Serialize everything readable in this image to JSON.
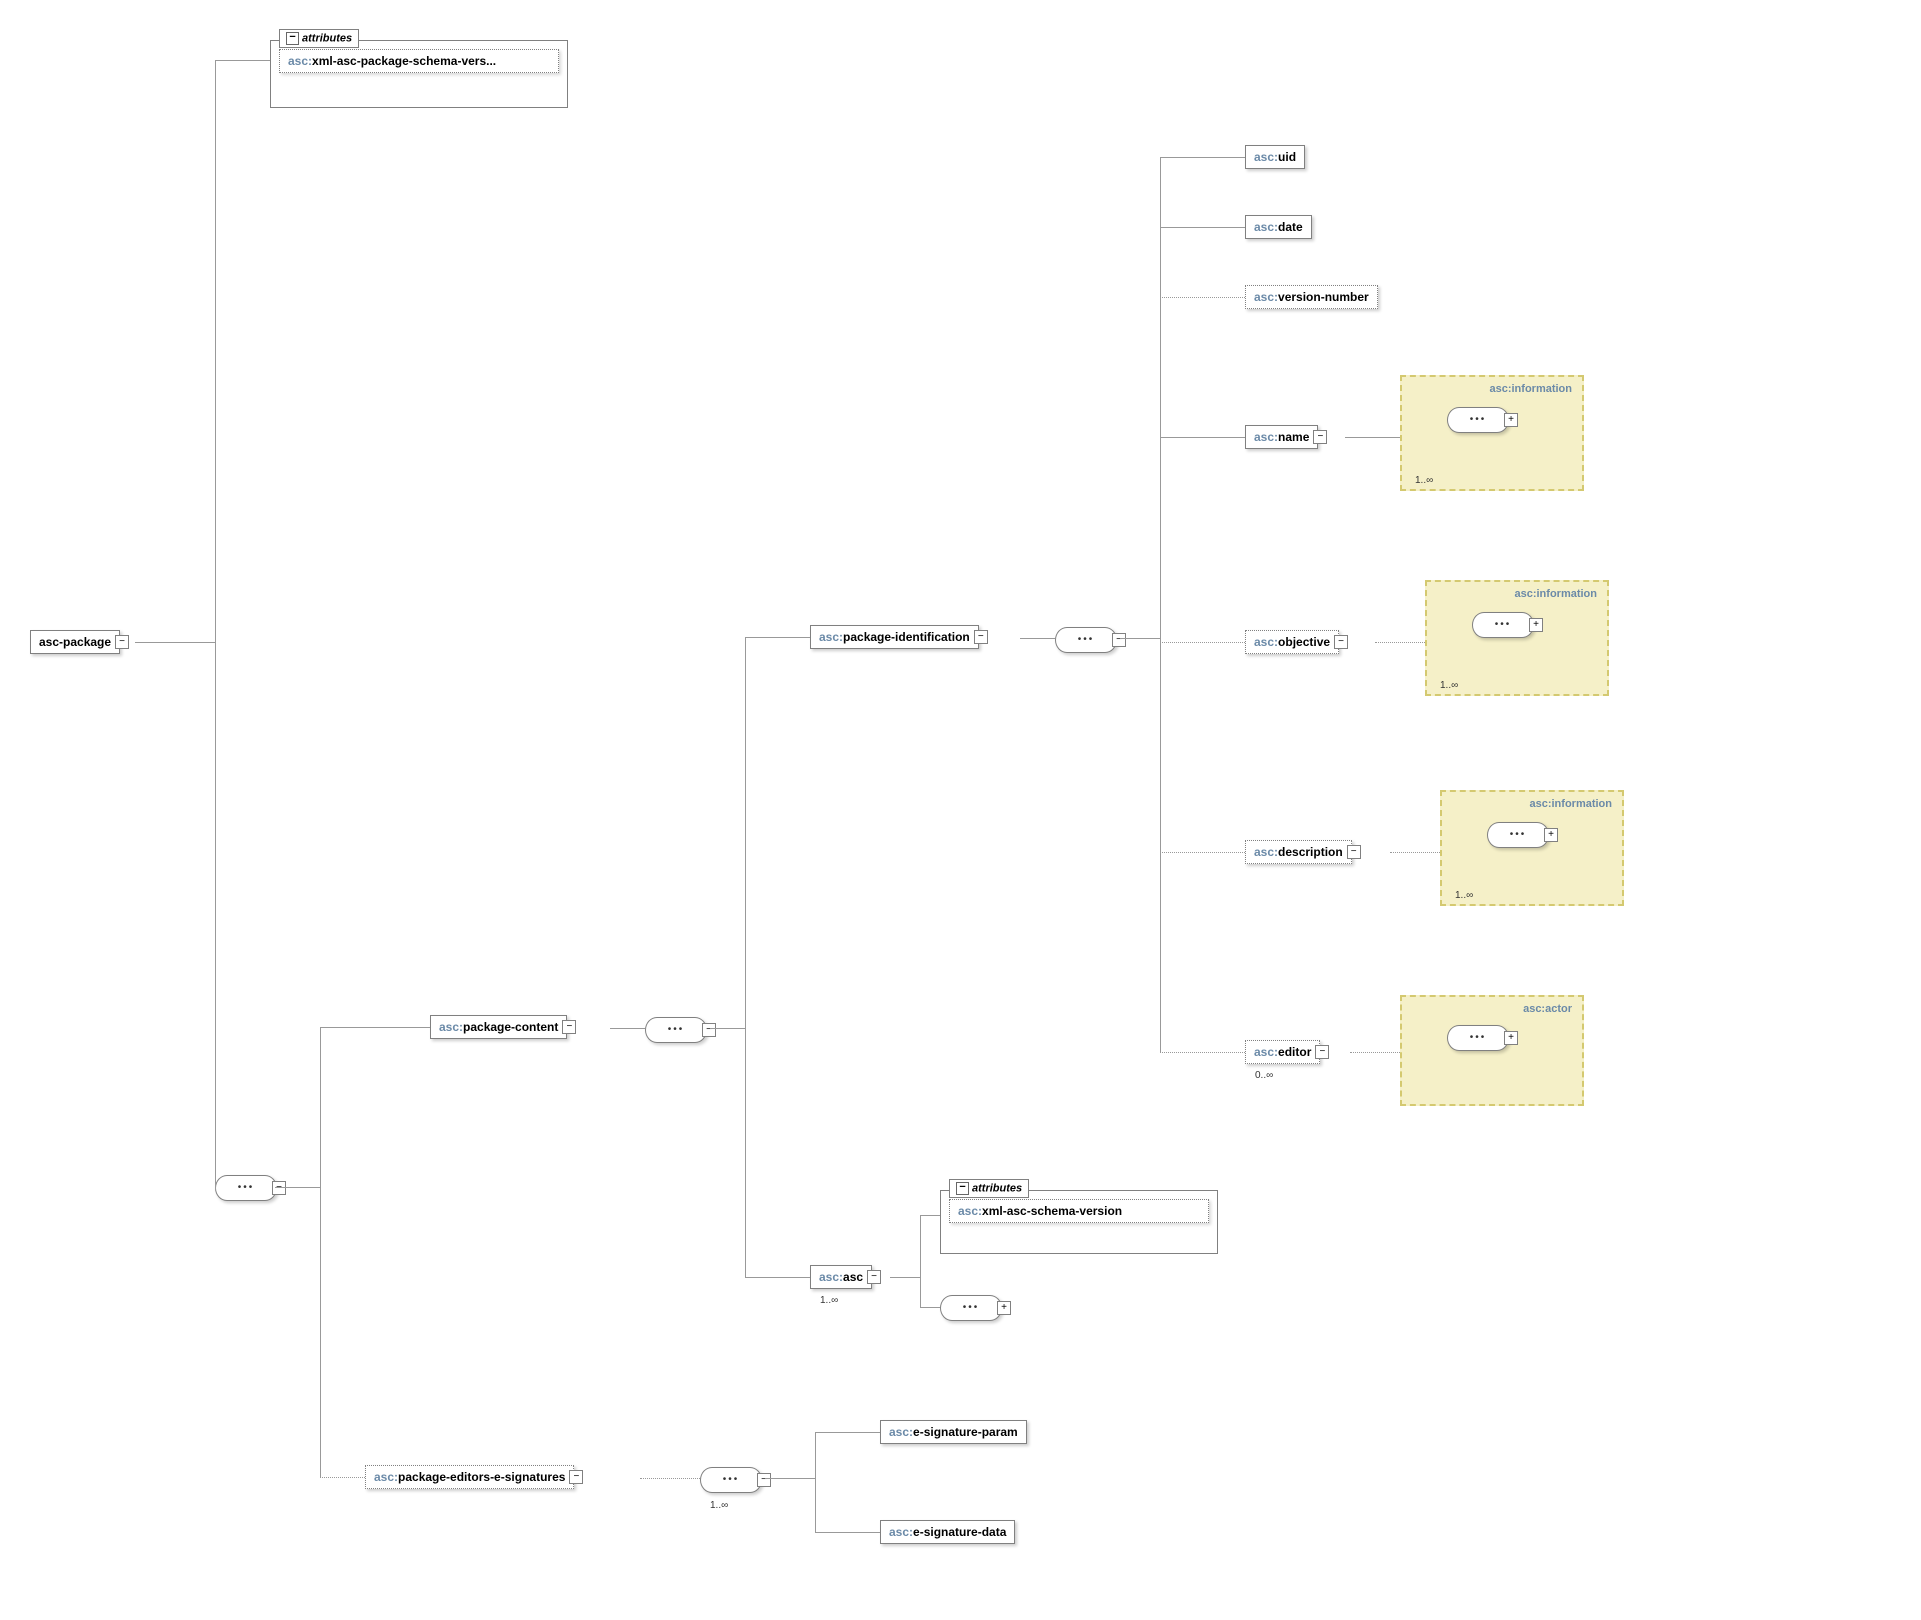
{
  "root": {
    "label": "asc-package"
  },
  "attributes": {
    "header": "attributes",
    "item": {
      "prefix": "asc:",
      "name": "xml-asc-package-schema-vers..."
    }
  },
  "package_content": {
    "prefix": "asc:",
    "name": "package-content"
  },
  "package_editors_esig": {
    "prefix": "asc:",
    "name": "package-editors-e-signatures"
  },
  "package_identification": {
    "prefix": "asc:",
    "name": "package-identification"
  },
  "asc_asc": {
    "prefix": "asc:",
    "name": "asc",
    "card": "1..∞"
  },
  "asc_attributes": {
    "header": "attributes",
    "item": {
      "prefix": "asc:",
      "name": "xml-asc-schema-version"
    }
  },
  "uid": {
    "prefix": "asc:",
    "name": "uid"
  },
  "date": {
    "prefix": "asc:",
    "name": "date"
  },
  "version_number": {
    "prefix": "asc:",
    "name": "version-number"
  },
  "name_el": {
    "prefix": "asc:",
    "name": "name"
  },
  "objective": {
    "prefix": "asc:",
    "name": "objective"
  },
  "description": {
    "prefix": "asc:",
    "name": "description"
  },
  "editor": {
    "prefix": "asc:",
    "name": "editor",
    "card": "0..∞"
  },
  "group_information": {
    "title": "asc:information",
    "card": "1..∞"
  },
  "group_actor": {
    "title": "asc:actor"
  },
  "esig_param": {
    "prefix": "asc:",
    "name": "e-signature-param"
  },
  "esig_data": {
    "prefix": "asc:",
    "name": "e-signature-data"
  },
  "esig_card": "1..∞"
}
